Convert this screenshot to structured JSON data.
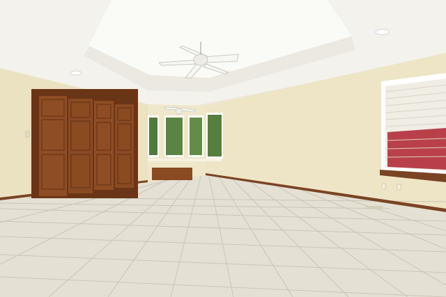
{
  "scene": {
    "kind": "empty-room-interior",
    "colors": {
      "wall": "#ede4c4",
      "wall_shadow": "#dcd3b2",
      "ceiling": "#f5f4ef",
      "tray_ceiling": "#fbfbf8",
      "floor_tile": "#e3dfd3",
      "grout": "#c9c3b3",
      "wood_door": "#8a4a22",
      "wood_dark": "#6a3516",
      "baseboard": "#7a4424",
      "window_glass": "#4f7a3c",
      "blind": "#f0ede4",
      "brick": "#b9404a"
    }
  }
}
